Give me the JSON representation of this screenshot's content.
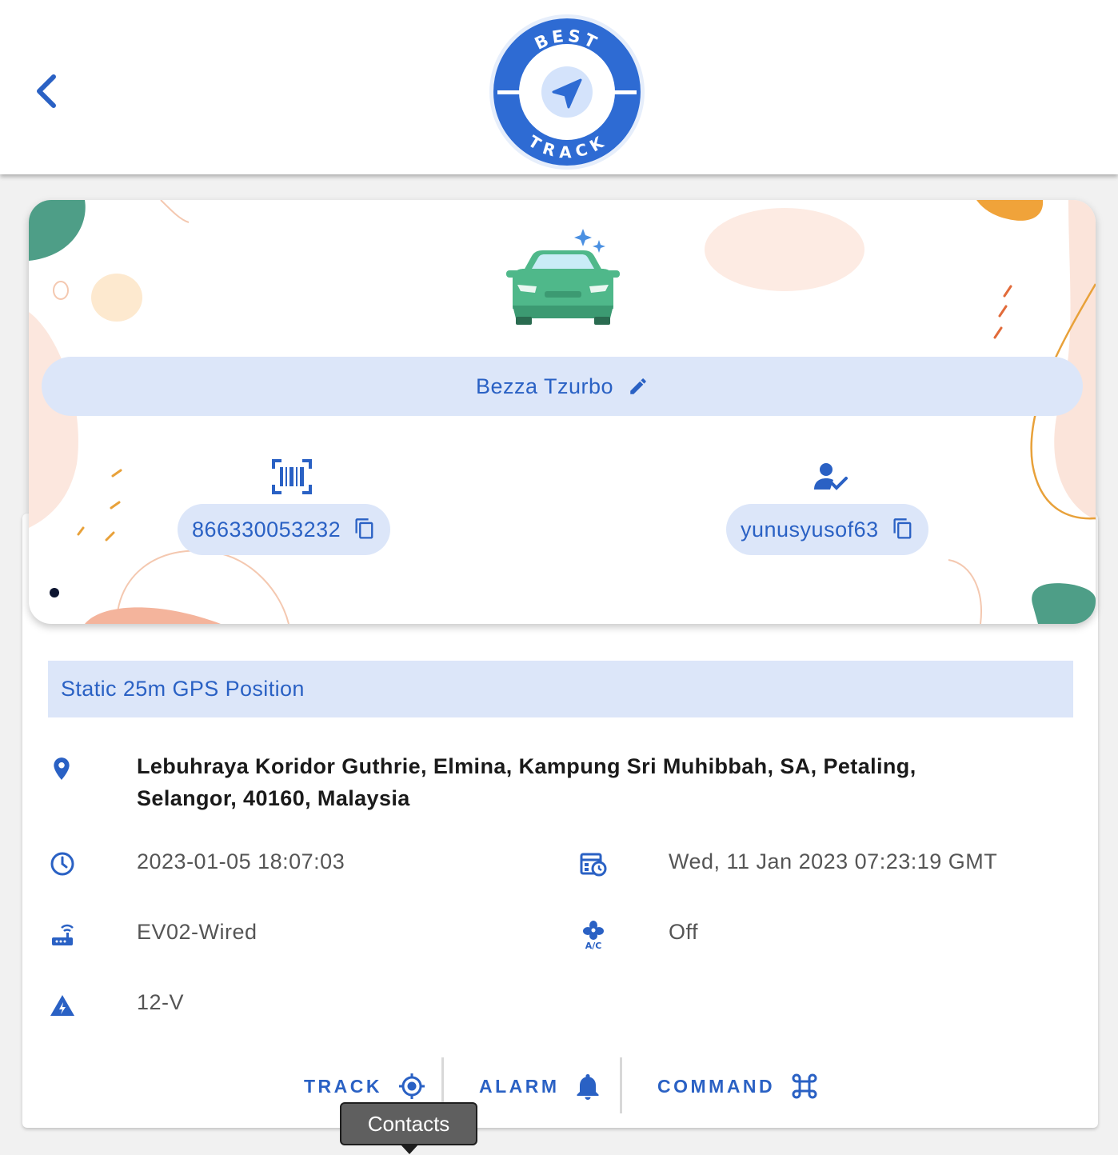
{
  "header": {
    "logo": {
      "top_text": "BEST",
      "bottom_text": "TRACK",
      "icon": "navigation-arrow-icon"
    },
    "back_icon": "chevron-left-icon"
  },
  "vehicle_card": {
    "car_icon": "car-icon",
    "name": "Bezza Tzurbo",
    "name_edit_icon": "pencil-icon",
    "imei": {
      "icon": "barcode-scan-icon",
      "value": "866330053232",
      "copy_icon": "copy-icon"
    },
    "owner": {
      "icon": "account-check-icon",
      "value": "yunusyusof63",
      "copy_icon": "copy-icon"
    }
  },
  "position": {
    "status": "Static 25m GPS Position",
    "address": "Lebuhraya Koridor Guthrie, Elmina, Kampung Sri Muhibbah, SA, Petaling, Selangor, 40160, Malaysia"
  },
  "details": {
    "gps_time": "2023-01-05 18:07:03",
    "server_time": "Wed, 11 Jan 2023 07:23:19 GMT",
    "device_model": "EV02-Wired",
    "ac_status": "Off",
    "voltage": "12-V"
  },
  "actions": {
    "track": "TRACK",
    "alarm": "ALARM",
    "command": "COMMAND"
  },
  "tooltip": {
    "text": "Contacts"
  },
  "colors": {
    "accent": "#2a61c4",
    "chip_bg": "#dce6f9",
    "car": "#4fb88a",
    "logo_blue": "#2e6bd3"
  }
}
